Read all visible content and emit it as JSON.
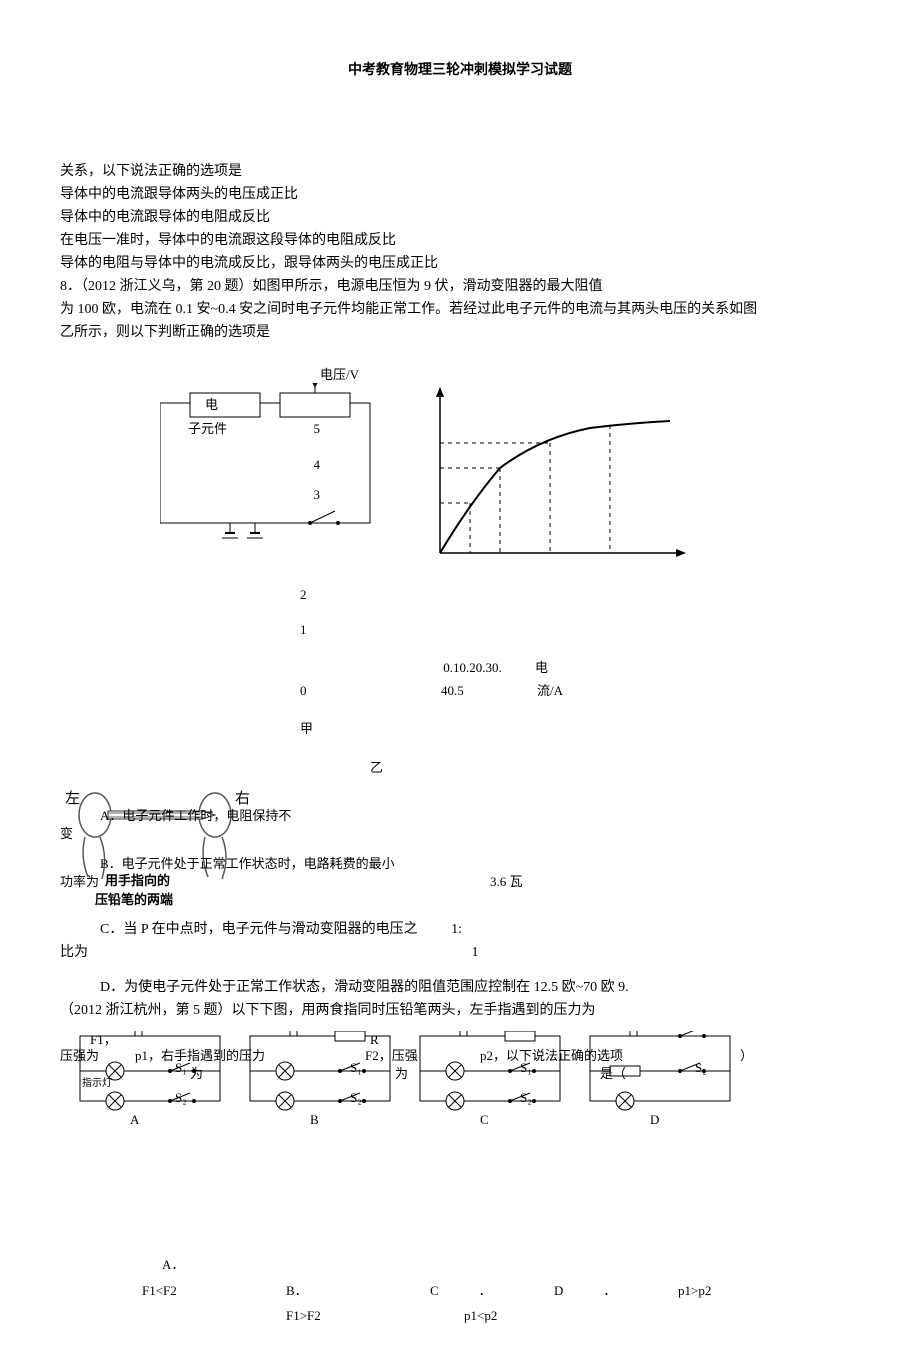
{
  "header": {
    "title": "中考教育物理三轮冲刺模拟学习试题"
  },
  "q7": {
    "stem": "关系，以下说法正确的选项是",
    "optA": "导体中的电流跟导体两头的电压成正比",
    "optB": "导体中的电流跟导体的电阻成反比",
    "optC": "在电压一准时，导体中的电流跟这段导体的电阻成反比",
    "optD": "导体的电阻与导体中的电流成反比，跟导体两头的电压成正比"
  },
  "q8": {
    "num": "8．",
    "src": "（2012 浙江义乌，第 20 题）如图甲所示，电源电压恒为 9 伏，滑动变阻器的最大阻值",
    "body1": "为 100 欧，电流在 0.1 安~0.4 安之间时电子元件均能正常工作。若经过此电子元件的电流与其两头电压的关系如图",
    "body2": "乙所示，则以下判断正确的选项是",
    "circuit_label1": "电",
    "circuit_label2": "子元件",
    "y_label": "电压/V",
    "y5": "5",
    "y4": "4",
    "y3": "3",
    "y2": "2",
    "y1": "1",
    "y0": "0",
    "x_ticks": "0.10.20.30.",
    "x_last": "40.5",
    "x_label1": "电",
    "x_label2": "流/A",
    "cap1": "甲",
    "cap2": "乙",
    "optA_1": "A．电子元件工作时，电阻保持不",
    "optA_2": "变",
    "optB_1": "B．电子元件处于正常工作状态时，电路耗费的最小",
    "optB_2": "功率为",
    "optB_val": "3.6 瓦",
    "pencil_text1": "用手指向的",
    "pencil_text2": "压铅笔的两端",
    "pencil_left": "左",
    "pencil_right": "右",
    "optC_1": "C．当 P 在中点时，电子元件与滑动变阻器的电压之",
    "optC_2": "比为",
    "optC_val1": "1:",
    "optC_val2": "1",
    "optD": "D．为使电子元件处于正常工作状态，滑动变阻器的阻值范围应控制在 12.5 欧~70 欧 9."
  },
  "q9": {
    "src": "（2012 浙江杭州，第 5 题）以下下图，用两食指同时压铅笔两头，左手指遇到的压力为",
    "line1_a": "F1，",
    "line1_b": "压强为",
    "line1_c": "p1，右手指遇到的压力",
    "line1_d": "F2，压强",
    "line1_e": "p2，以下说法正确的选项",
    "line1_f": "）",
    "line2_a": "为",
    "line2_b": "为",
    "line2_c": "是（",
    "indicator": "指示灯",
    "labA": "A",
    "labB": "B",
    "labC": "C",
    "labD": "D",
    "s1": "S₁",
    "s2": "S₂",
    "r": "R",
    "optA_lab": "A．",
    "optA_val": "F1<F2",
    "optB_lab": "B．",
    "optB_val": "F1>F2",
    "optC_lab": "C",
    "optC_dot": "．",
    "optC_val": "p1<p2",
    "optD_lab": "D",
    "optD_dot": "．",
    "optD_val": "p1>p2"
  }
}
